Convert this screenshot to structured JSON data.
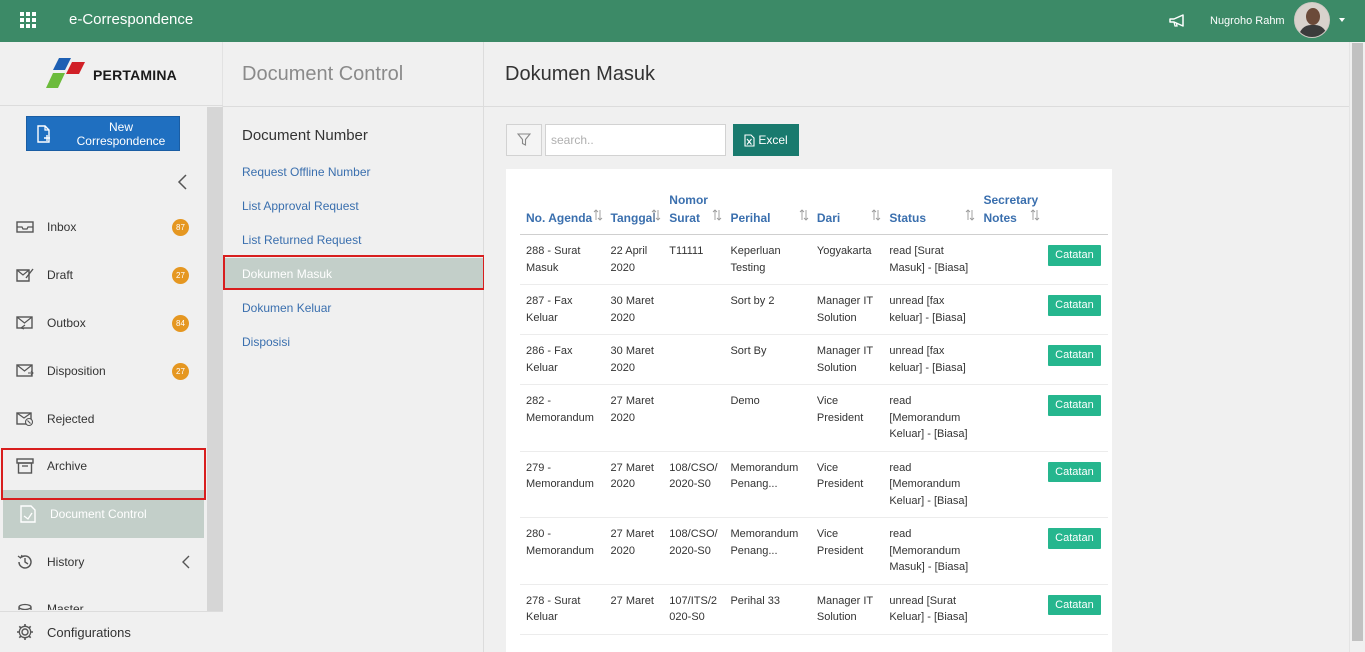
{
  "app": {
    "title": "e-Correspondence",
    "user_name": "Nugroho Rahm",
    "brand_color": "#3c8a67"
  },
  "logo": {
    "text": "PERTAMINA"
  },
  "sidebar": {
    "new_button_label": "New Correspondence",
    "items": [
      {
        "label": "Inbox",
        "badge": "87",
        "icon": "inbox-icon"
      },
      {
        "label": "Draft",
        "badge": "27",
        "icon": "draft-icon"
      },
      {
        "label": "Outbox",
        "badge": "84",
        "icon": "outbox-icon"
      },
      {
        "label": "Disposition",
        "badge": "27",
        "icon": "disposition-icon"
      },
      {
        "label": "Rejected",
        "icon": "rejected-icon"
      },
      {
        "label": "Archive",
        "icon": "archive-icon"
      },
      {
        "label": "Document Control",
        "icon": "document-control-icon",
        "active": true
      },
      {
        "label": "History",
        "icon": "history-icon"
      },
      {
        "label": "Master",
        "icon": "master-icon"
      }
    ],
    "config_label": "Configurations"
  },
  "midpanel": {
    "title": "Document Control",
    "subtitle": "Document Number",
    "links": [
      "Request Offline Number",
      "List Approval Request",
      "List Returned Request",
      "Dokumen Masuk",
      "Dokumen Keluar",
      "Disposisi"
    ],
    "active_link": "Dokumen Masuk"
  },
  "main": {
    "title": "Dokumen Masuk",
    "search_placeholder": "search..",
    "excel_label": "Excel",
    "columns": [
      "No. Agenda",
      "Tanggal",
      "Nomor Surat",
      "Perihal",
      "Dari",
      "Status",
      "Secretary Notes"
    ],
    "action_label": "Catatan",
    "rows": [
      {
        "agenda": "288 - Surat Masuk",
        "tanggal": "22 April 2020",
        "nomor": "T11111",
        "perihal": "Keperluan Testing",
        "dari": "Yogyakarta",
        "status": "read [Surat Masuk] - [Biasa]"
      },
      {
        "agenda": "287 - Fax Keluar",
        "tanggal": "30 Maret 2020",
        "nomor": "",
        "perihal": "Sort by 2",
        "dari": "Manager IT Solution",
        "status": "unread [fax keluar] - [Biasa]"
      },
      {
        "agenda": "286 - Fax Keluar",
        "tanggal": "30 Maret 2020",
        "nomor": "",
        "perihal": "Sort By",
        "dari": "Manager IT Solution",
        "status": "unread [fax keluar] - [Biasa]"
      },
      {
        "agenda": "282 - Memorandum",
        "tanggal": "27 Maret 2020",
        "nomor": "",
        "perihal": "Demo",
        "dari": "Vice President",
        "status": "read [Memorandum Keluar] - [Biasa]"
      },
      {
        "agenda": "279 - Memorandum",
        "tanggal": "27 Maret 2020",
        "nomor": "108/CSO/2020-S0",
        "perihal": "Memorandum Penang...",
        "dari": "Vice President",
        "status": "read [Memorandum Keluar] - [Biasa]"
      },
      {
        "agenda": "280 - Memorandum",
        "tanggal": "27 Maret 2020",
        "nomor": "108/CSO/2020-S0",
        "perihal": "Memorandum Penang...",
        "dari": "Vice President",
        "status": "read [Memorandum Masuk] - [Biasa]"
      },
      {
        "agenda": "278 - Surat Keluar",
        "tanggal": "27 Maret",
        "nomor": "107/ITS/2020-S0",
        "perihal": "Perihal 33",
        "dari": "Manager IT Solution",
        "status": "unread [Surat Keluar] - [Biasa]"
      }
    ]
  }
}
